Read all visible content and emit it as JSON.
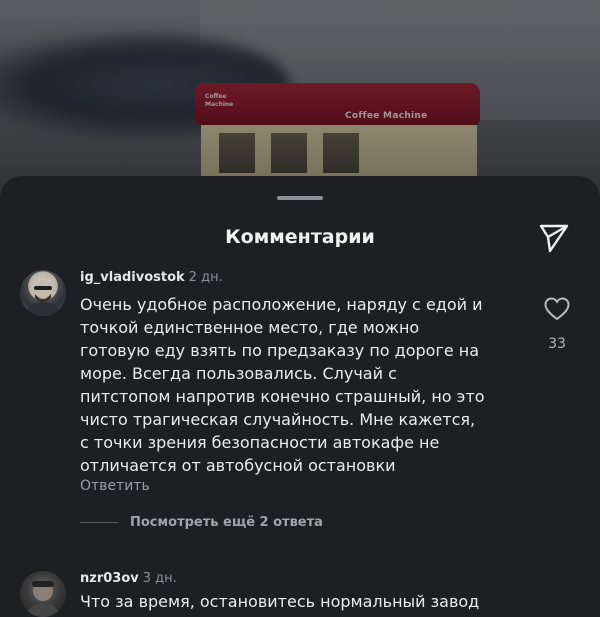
{
  "background": {
    "kiosk_brand": "Coffee Machine",
    "kiosk_brand_small": "Coffee Machine"
  },
  "sheet": {
    "title": "Комментарии",
    "share_icon": "send-icon"
  },
  "comments": [
    {
      "username": "ig_vladivostok",
      "time": "2 дн.",
      "text": "Очень удобное расположение, наряду с едой и\nточкой единственное место, где можно\nготовую еду взять по предзаказу по дороге на\nморе. Всегда пользовались. Случай с\nпитстопом напротив конечно страшный, но это\nчисто трагическая случайность. Мне кажется,\nс точки зрения безопасности автокафе не\nотличается от автобусной остановки",
      "reply_label": "Ответить",
      "likes": "33",
      "more_replies": "Посмотреть ещё 2 ответа"
    },
    {
      "username": "nzr03ov",
      "time": "3 дн.",
      "text": "Что за время, остановитесь нормальный завод"
    }
  ],
  "colors": {
    "sheet_bg": "#1e1f23",
    "text": "#ececee",
    "muted": "#8e8f95",
    "kiosk_red": "#a8283b"
  }
}
